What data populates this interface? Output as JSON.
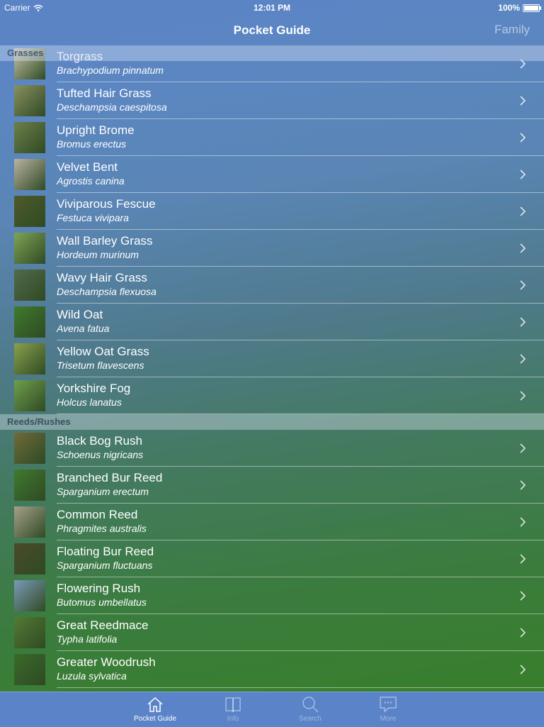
{
  "status": {
    "carrier": "Carrier",
    "time": "12:01 PM",
    "battery": "100%"
  },
  "nav": {
    "title": "Pocket Guide",
    "right_label": "Family"
  },
  "sections": [
    {
      "title": "Grasses"
    },
    {
      "title": "Reeds/Rushes"
    }
  ],
  "grasses": [
    {
      "name": "Torgrass",
      "latin": "Brachypodium pinnatum",
      "thumb": "#c8c4a8"
    },
    {
      "name": "Tufted Hair Grass",
      "latin": "Deschampsia caespitosa",
      "thumb": "#8a9060"
    },
    {
      "name": "Upright Brome",
      "latin": "Bromus erectus",
      "thumb": "#6d7f4a"
    },
    {
      "name": "Velvet Bent",
      "latin": "Agrostis canina",
      "thumb": "#b9b2a0"
    },
    {
      "name": "Viviparous Fescue",
      "latin": "Festuca vivipara",
      "thumb": "#4f5a2c"
    },
    {
      "name": "Wall Barley Grass",
      "latin": "Hordeum murinum",
      "thumb": "#7ea454"
    },
    {
      "name": "Wavy Hair Grass",
      "latin": "Deschampsia flexuosa",
      "thumb": "#526a4a"
    },
    {
      "name": "Wild Oat",
      "latin": "Avena fatua",
      "thumb": "#3f7a2c"
    },
    {
      "name": "Yellow Oat Grass",
      "latin": "Trisetum flavescens",
      "thumb": "#8aa04a"
    },
    {
      "name": "Yorkshire Fog",
      "latin": "Holcus lanatus",
      "thumb": "#6e9f4c"
    }
  ],
  "reeds": [
    {
      "name": "Black Bog Rush",
      "latin": "Schoenus nigricans",
      "thumb": "#6f6a3a"
    },
    {
      "name": "Branched Bur Reed",
      "latin": "Sparganium erectum",
      "thumb": "#3f7a2e"
    },
    {
      "name": "Common Reed",
      "latin": "Phragmites australis",
      "thumb": "#a6a08a"
    },
    {
      "name": "Floating Bur Reed",
      "latin": "Sparganium fluctuans",
      "thumb": "#4b4a2a"
    },
    {
      "name": "Flowering Rush",
      "latin": "Butomus umbellatus",
      "thumb": "#7a9ab8"
    },
    {
      "name": "Great Reedmace",
      "latin": "Typha latifolia",
      "thumb": "#547a34"
    },
    {
      "name": "Greater Woodrush",
      "latin": "Luzula sylvatica",
      "thumb": "#3a6a2a"
    }
  ],
  "tabs": [
    {
      "label": "Pocket Guide",
      "icon": "home-icon"
    },
    {
      "label": "Info",
      "icon": "book-icon"
    },
    {
      "label": "Search",
      "icon": "search-icon"
    },
    {
      "label": "More",
      "icon": "more-icon"
    }
  ]
}
